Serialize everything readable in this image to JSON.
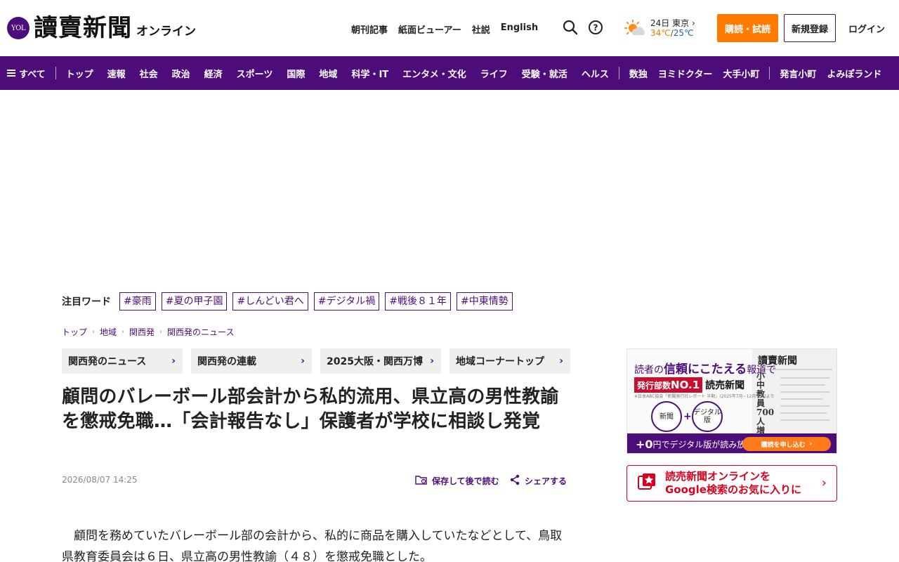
{
  "header": {
    "logo_mark": "YOL",
    "logo_text": "讀賣新聞",
    "logo_sub": "オンライン",
    "links": [
      "朝刊記事",
      "紙面ビューアー",
      "社説",
      "English"
    ],
    "weather": {
      "date": "24日",
      "city": "東京",
      "high": "34℃",
      "separator": "/",
      "low": "25℃"
    },
    "subscribe": "購読・試読",
    "register": "新規登録",
    "login": "ログイン"
  },
  "nav": {
    "all": "すべて",
    "items": [
      "トップ",
      "速報",
      "社会",
      "政治",
      "経済",
      "スポーツ",
      "国際",
      "地域",
      "科学・IT",
      "エンタメ・文化",
      "ライフ",
      "受験・就活",
      "ヘルス"
    ],
    "items2": [
      "数独",
      "ヨミドクター",
      "大手小町"
    ],
    "items3": [
      "発言小町",
      "よみぽランド"
    ]
  },
  "hot_words": {
    "label": "注目ワード",
    "tags": [
      "#豪雨",
      "#夏の甲子園",
      "#しんどい君へ",
      "#デジタル禍",
      "#戦後８１年",
      "#中東情勢"
    ]
  },
  "breadcrumb": [
    "トップ",
    "地域",
    "関西発",
    "関西発のニュース"
  ],
  "categories": [
    "関西発のニュース",
    "関西発の連載",
    "2025大阪・関西万博",
    "地域コーナートップ"
  ],
  "article": {
    "title": "顧問のバレーボール部会計から私的流用、県立高の男性教諭を懲戒免職…「会計報告なし」保護者が学校に相談し発覚",
    "datetime": "2026/08/07 14:25",
    "save_label": "保存して後で読む",
    "share_label": "シェアする",
    "body": "顧問を務めていたバレーボール部の会計から、私的に商品を購入していたなどとして、鳥取県教育委員会は６日、県立高の男性教諭（４８）を懲戒免職とした。"
  },
  "promo": {
    "headline_pre": "読者の",
    "headline_em": "信頼にこたえる",
    "headline_post": "報道で",
    "badge_pre": "発行部数",
    "badge_no1": "NO.1",
    "paper": "読売新聞",
    "fine": "※日本ABC協会「新聞発行社レポート 半期」(2025年7月~12月平均)より",
    "circle1": "新聞",
    "plus": "+",
    "circle2": "デジタル版",
    "np_title": "讀賣新聞",
    "np_head": "小中教員700人増",
    "bar_pre": "+0",
    "bar_post": "円でデジタル版が読み放題！",
    "cta": "購読を申し込む"
  },
  "google_box": {
    "line1": "読売新聞オンラインを",
    "line2": "Google検索のお気に入りに"
  },
  "colors": {
    "brand": "#4c0c79",
    "accent": "#ff7a00",
    "google_red": "#d9001b"
  }
}
